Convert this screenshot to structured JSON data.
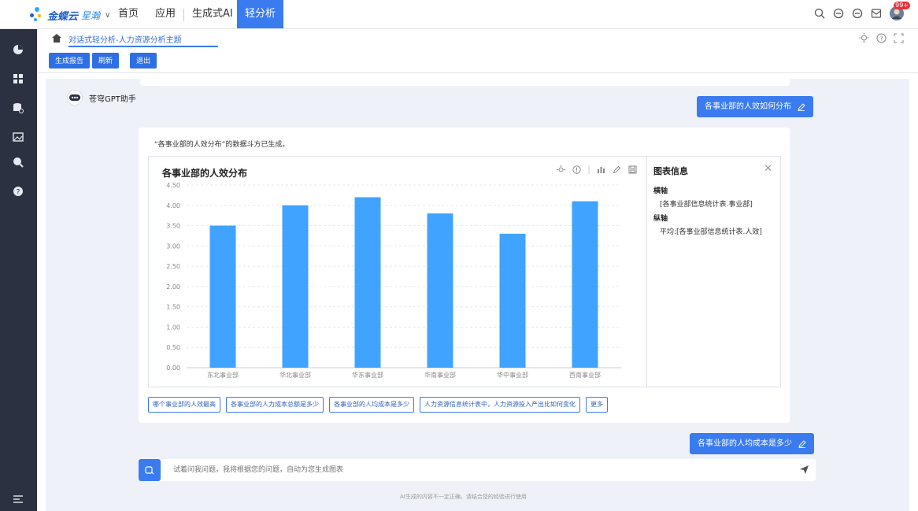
{
  "brand": {
    "name": "金蝶云",
    "sub": "星瀚",
    "caret": "∨"
  },
  "nav": {
    "home": "首页",
    "apps": "应用",
    "genai": "生成式AI",
    "active": "轻分析"
  },
  "notifications": {
    "badge": "99+"
  },
  "breadcrumb": {
    "title": "对话式轻分析-人力资源分析主题"
  },
  "toolbar": {
    "generate_report": "生成报告",
    "refresh": "刷新",
    "exit": "退出"
  },
  "assistant": {
    "name": "苍穹GPT助手"
  },
  "conversation": {
    "user_question_1": "各事业部的人效如何分布",
    "result_message": "“各事业部的人效分布”的数据斗方已生成。",
    "user_question_2": "各事业部的人均成本是多少"
  },
  "chart_info": {
    "title": "图表信息",
    "x_label": "横轴",
    "x_value": "[各事业部信息统计表.事业部]",
    "y_label": "纵轴",
    "y_value": "平均:[各事业部信息统计表.人效]"
  },
  "suggestions": [
    "哪个事业部的人效最高",
    "各事业部的人力成本总额是多少",
    "各事业部的人均成本是多少",
    "人力资源信息统计表中，人力资源投入产出比如何变化",
    "更多"
  ],
  "input": {
    "placeholder": "试着问我问题，我将根据您的问题，自动为您生成图表"
  },
  "disclaimer": "AI生成的内容不一定正确，请结合您的经验进行使用",
  "colors": {
    "accent": "#3a7bf0",
    "bar": "#40a3ff",
    "sidebar": "#2b3140"
  },
  "chart_data": {
    "type": "bar",
    "title": "各事业部的人效分布",
    "categories": [
      "东北事业部",
      "华北事业部",
      "华东事业部",
      "华南事业部",
      "华中事业部",
      "西南事业部"
    ],
    "values": [
      3.5,
      4.0,
      4.2,
      3.8,
      3.3,
      4.1
    ],
    "yticks": [
      "0.00",
      "0.50",
      "1.00",
      "1.50",
      "2.00",
      "2.50",
      "3.00",
      "3.50",
      "4.00",
      "4.50"
    ],
    "ylim": [
      0,
      4.5
    ],
    "grid": true
  }
}
